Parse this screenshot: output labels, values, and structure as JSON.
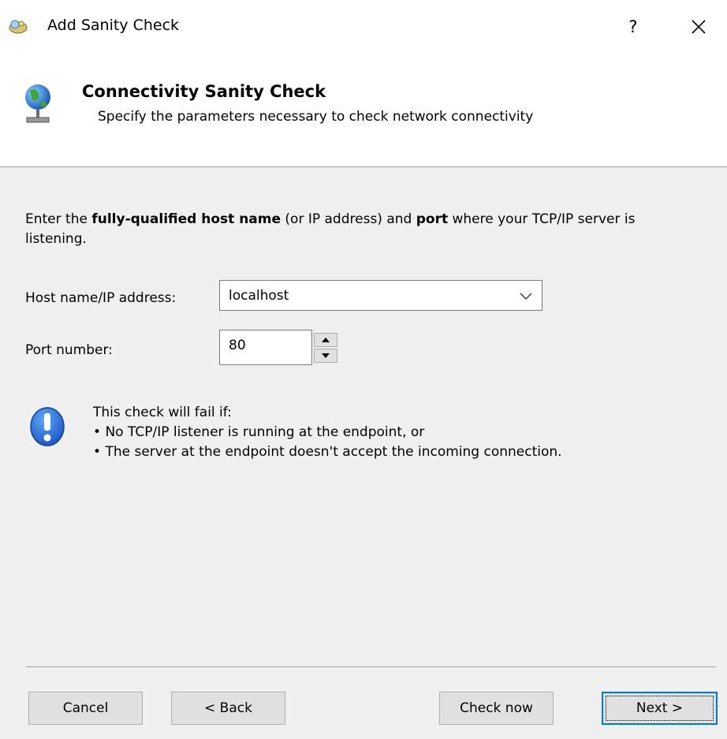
{
  "window": {
    "title": "Add Sanity Check",
    "help_label": "?",
    "close_label": "✕"
  },
  "header": {
    "title": "Connectivity Sanity Check",
    "subtitle": "Specify the parameters necessary to check network connectivity"
  },
  "intro": {
    "part1": "Enter the ",
    "bold1": "fully-qualified host name",
    "part2": " (or IP address) and ",
    "bold2": "port",
    "part3": " where your TCP/IP server is listening."
  },
  "form": {
    "host_label": "Host name/IP address:",
    "host_value": "localhost",
    "port_label": "Port number:",
    "port_value": "80"
  },
  "info": {
    "heading": "This check will fail if:",
    "bullets": [
      "No TCP/IP listener is running at the endpoint, or",
      "The server at the endpoint doesn't accept the incoming connection."
    ]
  },
  "buttons": {
    "cancel": "Cancel",
    "back": "< Back",
    "check_now": "Check now",
    "next": "Next >"
  },
  "colors": {
    "accent": "#0078d7",
    "info_blue": "#1d64c8",
    "dialog_bg": "#f0f0f0"
  }
}
